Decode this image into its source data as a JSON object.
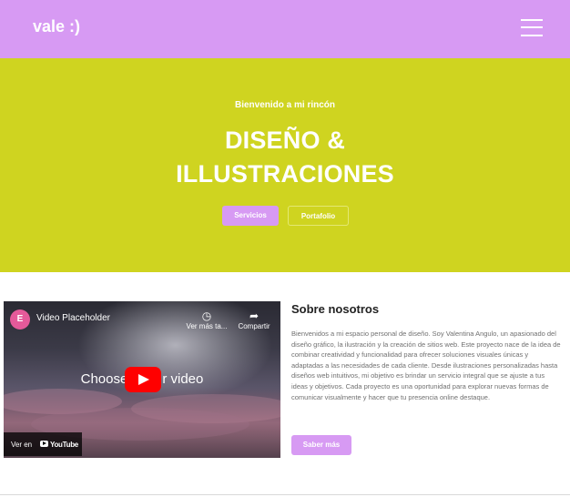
{
  "header": {
    "brand": "vale :)",
    "menu_icon": "hamburger-icon",
    "bg": "#d79af3"
  },
  "hero": {
    "kicker": "Bienvenido a mi rincón",
    "title_line1": "DISEÑO &",
    "title_line2": "ILLUSTRACIONES",
    "button_services": "Servicios",
    "button_portfolio": "Portafolio",
    "bg": "#cfd420"
  },
  "video": {
    "logo_letter": "E",
    "title": "Video Placeholder",
    "watch_later_label": "Ver más ta...",
    "watch_later_icon": "clock-icon",
    "share_label": "Compartir",
    "share_icon": "share-icon",
    "center_text_left": "Choose",
    "center_text_right": "r video",
    "watch_on": "Ver en",
    "youtube": "YouTube"
  },
  "about": {
    "title": "Sobre nosotros",
    "body": "Bienvenidos a mi espacio personal de diseño. Soy Valentina Angulo, un apasionado del diseño gráfico, la ilustración y la creación de sitios web. Este proyecto nace de la idea de combinar creatividad y funcionalidad para ofrecer soluciones visuales únicas y adaptadas a las necesidades de cada cliente. Desde ilustraciones personalizadas hasta diseños web intuitivos, mi objetivo es brindar un servicio integral que se ajuste a tus ideas y objetivos. Cada proyecto es una oportunidad para explorar nuevas formas de comunicar visualmente y hacer que tu presencia online destaque.",
    "button": "Saber más"
  }
}
